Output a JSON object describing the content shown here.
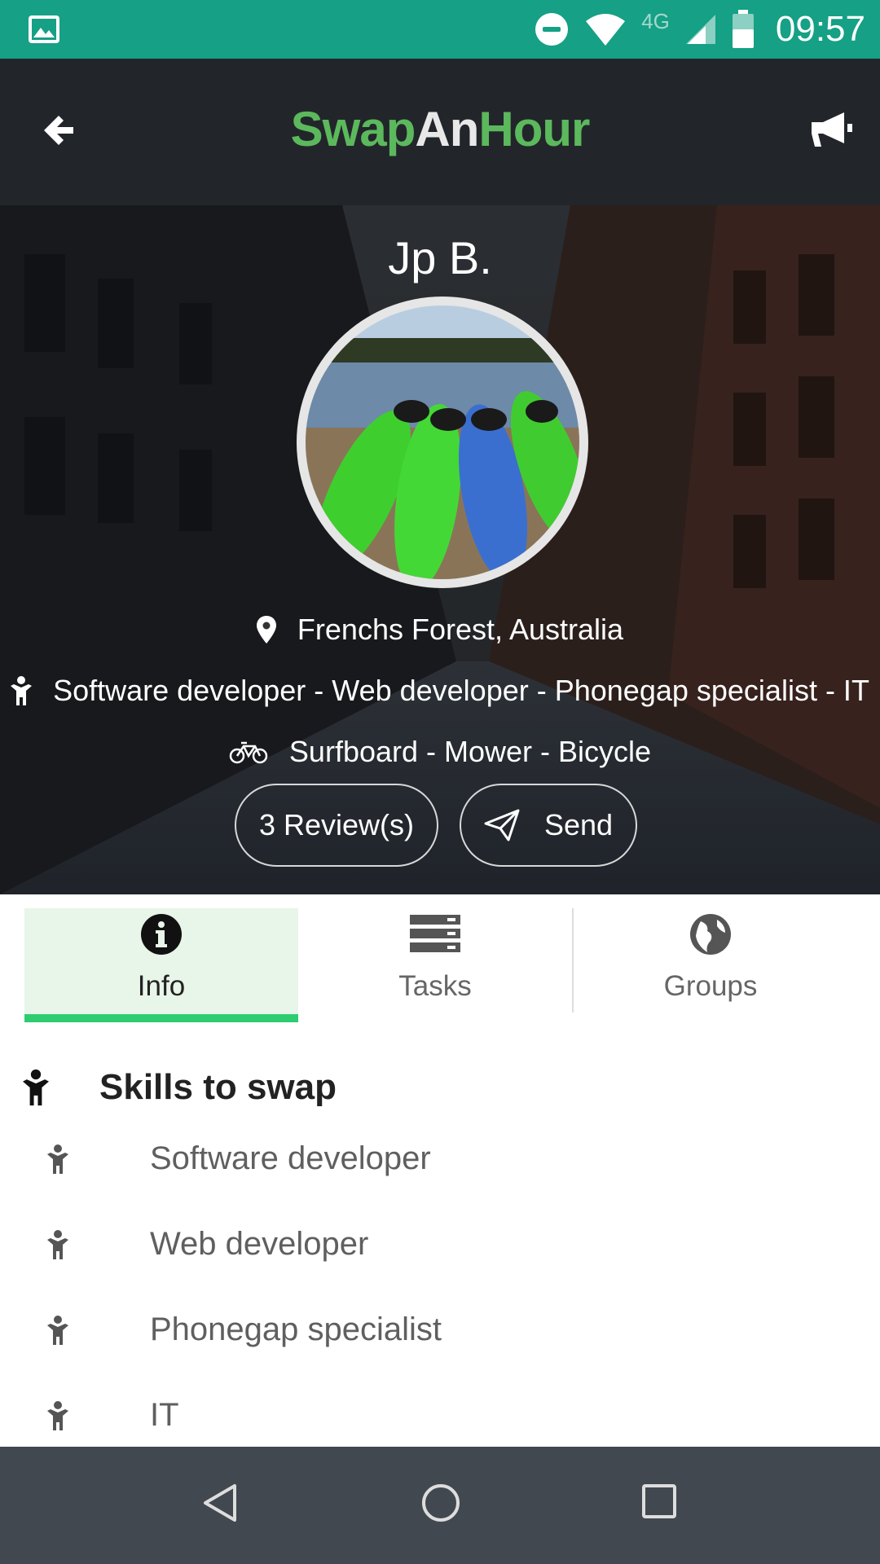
{
  "status_bar": {
    "network_label": "4G",
    "time": "09:57",
    "icons": [
      "gallery-icon",
      "dnd-icon",
      "wifi-icon",
      "signal-icon",
      "battery-icon"
    ]
  },
  "app_bar": {
    "logo_part1": "Swap",
    "logo_part2": "An",
    "logo_part3": "Hour",
    "icons": [
      "back-arrow-icon",
      "megaphone-icon"
    ]
  },
  "profile": {
    "name": "Jp B.",
    "location": "Frenchs Forest, Australia",
    "skills_summary": "Software developer - Web developer - Phonegap specialist - IT",
    "items_summary": "Surfboard - Mower - Bicycle",
    "reviews_button": "3 Review(s)",
    "send_button": "Send"
  },
  "tabs": [
    {
      "label": "Info",
      "icon": "info-icon",
      "active": true
    },
    {
      "label": "Tasks",
      "icon": "tasks-icon",
      "active": false
    },
    {
      "label": "Groups",
      "icon": "globe-icon",
      "active": false
    }
  ],
  "skills": {
    "title": "Skills to swap",
    "items": [
      "Software developer",
      "Web developer",
      "Phonegap specialist",
      "IT"
    ]
  },
  "colors": {
    "status_bar": "#16a085",
    "app_bar": "#22262b",
    "logo_green": "#5cb85c",
    "tab_active_bg": "#e8f5e9",
    "tab_underline": "#2ecc71",
    "nav_bar": "#424850"
  }
}
